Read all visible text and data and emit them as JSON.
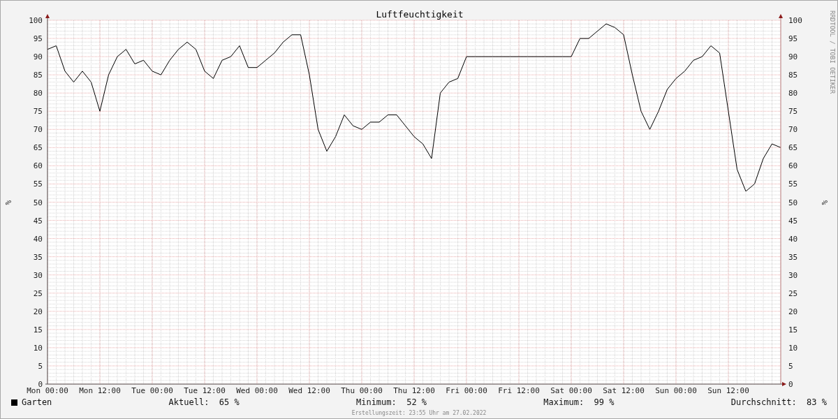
{
  "chart": {
    "chart_data": {
      "type": "line",
      "title": "Luftfeuchtigkeit",
      "ylabel": "%",
      "categories": [
        "Mon 00:00",
        null,
        null,
        null,
        null,
        null,
        "Mon 12:00",
        null,
        null,
        null,
        null,
        null,
        "Tue 00:00",
        null,
        null,
        null,
        null,
        null,
        "Tue 12:00",
        null,
        null,
        null,
        null,
        null,
        "Wed 00:00",
        null,
        null,
        null,
        null,
        null,
        "Wed 12:00",
        null,
        null,
        null,
        null,
        null,
        "Thu 00:00",
        null,
        null,
        null,
        null,
        null,
        "Thu 12:00",
        null,
        null,
        null,
        null,
        null,
        "Fri 00:00",
        null,
        null,
        null,
        null,
        null,
        "Fri 12:00",
        null,
        null,
        null,
        null,
        null,
        "Sat 00:00",
        null,
        null,
        null,
        null,
        null,
        "Sat 12:00",
        null,
        null,
        null,
        null,
        null,
        "Sun 00:00",
        null,
        null,
        null,
        null,
        null,
        "Sun 12:00",
        null,
        null,
        null,
        null,
        null,
        null
      ],
      "series": [
        {
          "name": "Garten",
          "color": "#000000",
          "values": [
            92,
            93,
            86,
            83,
            86,
            83,
            75,
            85,
            90,
            92,
            88,
            89,
            86,
            85,
            89,
            92,
            94,
            92,
            86,
            84,
            89,
            90,
            93,
            87,
            87,
            89,
            91,
            94,
            96,
            96,
            85,
            70,
            64,
            68,
            74,
            71,
            70,
            72,
            72,
            74,
            74,
            71,
            68,
            66,
            62,
            80,
            83,
            84,
            90,
            90,
            90,
            90,
            90,
            90,
            90,
            90,
            90,
            90,
            90,
            90,
            90,
            95,
            95,
            97,
            99,
            98,
            96,
            85,
            75,
            70,
            75,
            81,
            84,
            86,
            89,
            90,
            93,
            91,
            75,
            59,
            53,
            55,
            62,
            66,
            65
          ]
        }
      ],
      "ylim": [
        0,
        100
      ],
      "grid": true,
      "yticks": [
        0,
        5,
        10,
        15,
        20,
        25,
        30,
        35,
        40,
        45,
        50,
        55,
        60,
        65,
        70,
        75,
        80,
        85,
        90,
        95,
        100
      ]
    },
    "right_axis": {
      "label": "%",
      "ticks": [
        "100",
        "95",
        "90",
        "85",
        "80",
        "75",
        "70",
        "65",
        "60",
        "55",
        "50",
        "45",
        "40",
        "35",
        "30",
        "25",
        "20",
        "15",
        "10",
        "5",
        "0"
      ]
    },
    "side_credit": "RRDTOOL / TOBI OETIKER"
  },
  "legend": {
    "stats": [
      {
        "label": "Aktuell:",
        "value": "65 %"
      },
      {
        "label": "Minimum:",
        "value": "52 %"
      },
      {
        "label": "Maximum:",
        "value": "99 %"
      },
      {
        "label": "Durchschnitt:",
        "value": "83 %"
      }
    ]
  },
  "footer": "Erstellungszeit: 23:55 Uhr am 27.02.2022"
}
